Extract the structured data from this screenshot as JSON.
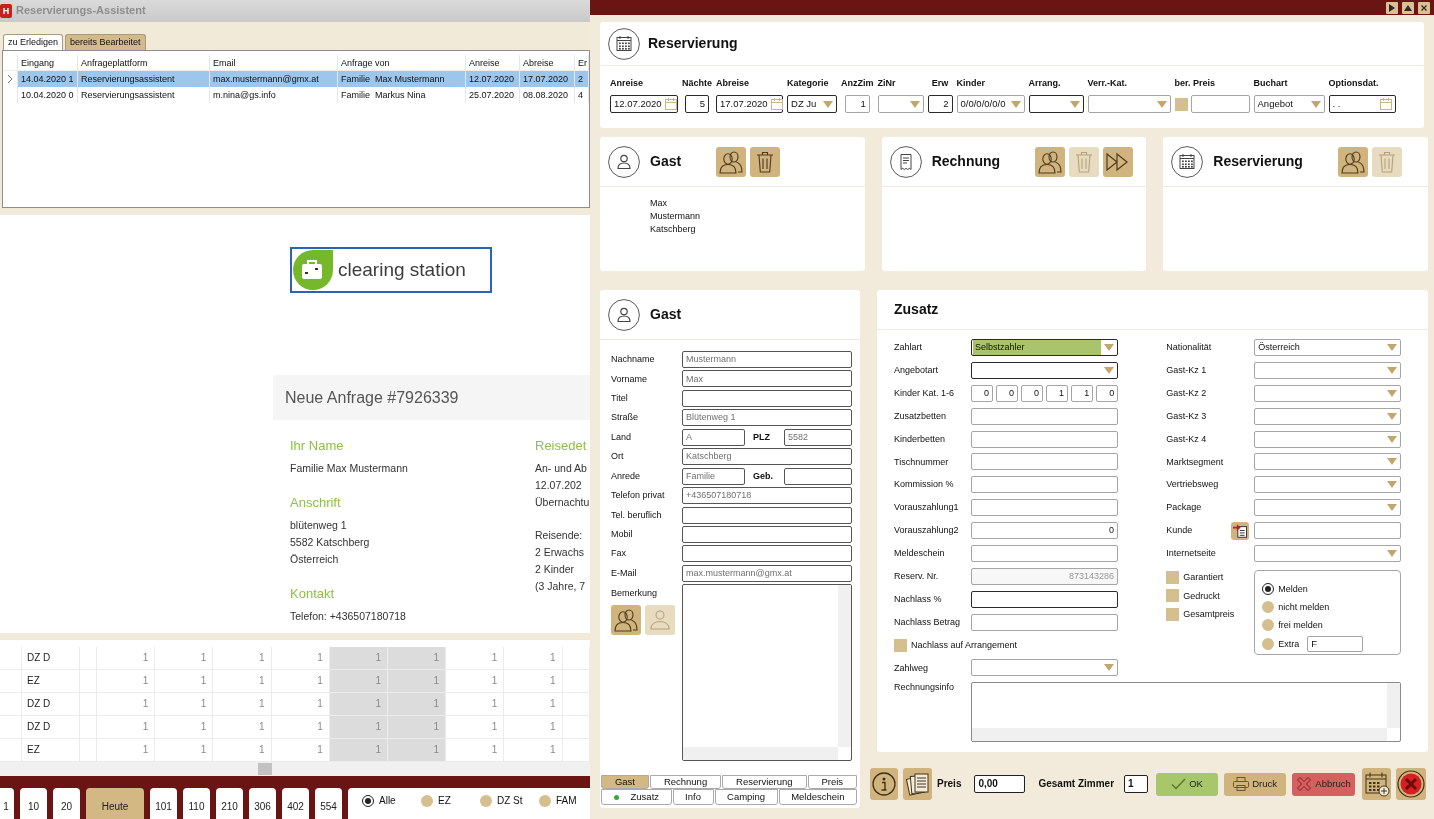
{
  "assistant": {
    "app_icon": "H",
    "title": "Reservierungs-Assistent",
    "tabs": [
      {
        "label": "zu Erledigen",
        "selected": true
      },
      {
        "label": "bereits Bearbeitet",
        "selected": false
      }
    ],
    "table": {
      "columns": [
        "Eingang",
        "Anfrageplattform",
        "Email",
        "Anfrage von",
        "Anreise",
        "Abreise",
        "Er"
      ],
      "rows": [
        {
          "selected": true,
          "cells": [
            "14.04.2020 1",
            "Reservierungsassistent",
            "max.mustermann@gmx.at",
            "Familie  Max Mustermann",
            "12.07.2020",
            "17.07.2020",
            "2"
          ]
        },
        {
          "selected": false,
          "cells": [
            "10.04.2020 0",
            "Reservierungsassistent",
            "m.nina@gs.info",
            "Familie  Markus Nina",
            "25.07.2020",
            "08.08.2020",
            "4"
          ]
        }
      ]
    }
  },
  "request_page": {
    "logo_text": "clearing station",
    "heading": "Neue Anfrage #7926339",
    "column_1": [
      {
        "title": "Ihr Name",
        "lines": [
          "Familie Max Mustermann"
        ]
      },
      {
        "title": "Anschrift",
        "lines": [
          "blütenweg 1",
          "5582 Katschberg",
          "Österreich"
        ]
      },
      {
        "title": "Kontakt",
        "lines": [
          "Telefon: +436507180718"
        ]
      }
    ],
    "column_2": [
      {
        "title": "Reisedet",
        "lines": [
          "An- und Ab",
          "12.07.202",
          "Übernachtu"
        ]
      },
      {
        "lines": [
          "Reisende:",
          "2 Erwachs",
          "2 Kinder",
          "(3 Jahre, 7"
        ]
      }
    ]
  },
  "room_grid": {
    "columns": [
      {
        "shaded": false
      },
      {
        "shaded": false
      },
      {
        "shaded": false
      },
      {
        "shaded": false
      },
      {
        "shaded": true
      },
      {
        "shaded": true
      },
      {
        "shaded": false
      },
      {
        "shaded": false
      }
    ],
    "rows": [
      {
        "label": "DZ D",
        "values": [
          "1",
          "1",
          "1",
          "1",
          "1",
          "1",
          "1",
          "1"
        ]
      },
      {
        "label": "EZ",
        "values": [
          "1",
          "1",
          "1",
          "1",
          "1",
          "1",
          "1",
          "1"
        ]
      },
      {
        "label": "DZ D",
        "values": [
          "1",
          "1",
          "1",
          "1",
          "1",
          "1",
          "1",
          "1"
        ]
      },
      {
        "label": "DZ D",
        "values": [
          "1",
          "1",
          "1",
          "1",
          "1",
          "1",
          "1",
          "1"
        ]
      },
      {
        "label": "EZ",
        "values": [
          "1",
          "1",
          "1",
          "1",
          "1",
          "1",
          "1",
          "1"
        ]
      }
    ]
  },
  "bottom_bar": {
    "buttons": [
      {
        "label": "1",
        "kind": "number"
      },
      {
        "label": "10",
        "kind": "number"
      },
      {
        "label": "20",
        "kind": "number"
      },
      {
        "label": "Heute",
        "kind": "today"
      },
      {
        "label": "101",
        "kind": "number"
      },
      {
        "label": "110",
        "kind": "number"
      },
      {
        "label": "210",
        "kind": "number"
      },
      {
        "label": "306",
        "kind": "number"
      },
      {
        "label": "402",
        "kind": "number"
      },
      {
        "label": "554",
        "kind": "number"
      }
    ],
    "filters": [
      {
        "label": "Alle",
        "selected": true
      },
      {
        "label": "EZ",
        "selected": false
      },
      {
        "label": "DZ St",
        "selected": false
      },
      {
        "label": "FAM",
        "selected": false
      }
    ]
  },
  "dialog": {
    "reservation": {
      "title": "Reservierung",
      "fields": [
        {
          "label": "Anreise",
          "kind": "date",
          "value": "12.07.2020",
          "emphasized": true
        },
        {
          "label": "Nächte",
          "kind": "number",
          "value": "5",
          "emphasized": true
        },
        {
          "label": "Abreise",
          "kind": "date",
          "value": "17.07.2020",
          "emphasized": true
        },
        {
          "label": "Kategorie",
          "kind": "select",
          "value": "DZ Ju",
          "emphasized": true
        },
        {
          "label": "AnzZim",
          "kind": "number",
          "value": "1",
          "emphasized": false
        },
        {
          "label": "ZiNr",
          "kind": "select",
          "emphasized": false
        },
        {
          "label": "Erw",
          "kind": "number",
          "value": "2",
          "emphasized": true
        },
        {
          "label": "Kinder",
          "kind": "select",
          "value": "0/0/0/0/0/0",
          "emphasized": false
        },
        {
          "label": "Arrang.",
          "kind": "select",
          "emphasized": true
        },
        {
          "label": "Verr.-Kat.",
          "kind": "select",
          "emphasized": false
        },
        {
          "label": "ber. Preis",
          "kind": "check_text",
          "checked": false,
          "emphasized": false
        },
        {
          "label": "Buchart",
          "kind": "select",
          "value": "Angebot",
          "emphasized": false
        },
        {
          "label": "Optionsdat.",
          "kind": "date",
          "value": ". .",
          "emphasized": true
        }
      ]
    },
    "cards": [
      {
        "title": "Gast",
        "kind": "guest",
        "buttons": [
          {
            "kind": "guests",
            "disabled": false
          },
          {
            "kind": "delete",
            "disabled": false
          }
        ],
        "lines": [
          "Max",
          "Mustermann",
          "Katschberg"
        ]
      },
      {
        "title": "Rechnung",
        "kind": "invoice",
        "buttons": [
          {
            "kind": "guests",
            "disabled": false
          },
          {
            "kind": "delete",
            "disabled": true
          },
          {
            "kind": "forward",
            "disabled": false
          }
        ]
      },
      {
        "title": "Reservierung",
        "kind": "reservation",
        "buttons": [
          {
            "kind": "guests",
            "disabled": false
          },
          {
            "kind": "delete",
            "disabled": true
          }
        ]
      }
    ],
    "guest_form": {
      "title": "Gast",
      "rows": [
        {
          "label": "Nachname",
          "value": "Mustermann"
        },
        {
          "label": "Vorname",
          "value": "Max"
        },
        {
          "label": "Titel"
        },
        {
          "label": "Straße",
          "value": "Blütenweg 1"
        },
        {
          "label": "Land",
          "value": "A",
          "second": {
            "label": "PLZ",
            "value": "5582"
          }
        },
        {
          "label": "Ort",
          "value": "Katschberg"
        },
        {
          "label": "Anrede",
          "value": "Familie",
          "second": {
            "label": "Geb."
          }
        },
        {
          "label": "Telefon privat",
          "value": "+436507180718"
        },
        {
          "label": "Tel. beruflich"
        },
        {
          "label": "Mobil"
        },
        {
          "label": "Fax"
        },
        {
          "label": "E-Mail",
          "value": "max.mustermann@gmx.at"
        }
      ],
      "remark_label": "Bemerkung",
      "buttons": [
        {
          "kind": "guests",
          "disabled": false
        },
        {
          "kind": "person",
          "disabled": true
        }
      ],
      "tabs": [
        [
          {
            "label": "Gast",
            "selected": true,
            "marked": false
          },
          {
            "label": "Rechnung",
            "selected": false,
            "marked": false
          },
          {
            "label": "Reservierung",
            "selected": false,
            "marked": false
          },
          {
            "label": "Preis",
            "selected": false,
            "marked": false
          }
        ],
        [
          {
            "label": "Zusatz",
            "selected": false,
            "marked": true
          },
          {
            "label": "Info",
            "selected": false,
            "marked": false
          },
          {
            "label": "Camping",
            "selected": false,
            "marked": false
          },
          {
            "label": "Meldeschein",
            "selected": false,
            "marked": false
          }
        ]
      ]
    },
    "extras": {
      "title": "Zusatz",
      "left": [
        {
          "label": "Zahlart",
          "kind": "select",
          "value": "Selbstzahler",
          "highlighted": true,
          "emphasized": true
        },
        {
          "label": "Angebotart",
          "kind": "select",
          "highlighted": false,
          "emphasized": true
        },
        {
          "label": "Kinder Kat. 1-6",
          "kind": "multi",
          "values": [
            "0",
            "0",
            "0",
            "1",
            "1",
            "0"
          ],
          "emphasized": false
        },
        {
          "label": "Zusatzbetten",
          "kind": "text",
          "emphasized": false
        },
        {
          "label": "Kinderbetten",
          "kind": "text",
          "emphasized": false
        },
        {
          "label": "Tischnummer",
          "kind": "text",
          "emphasized": false
        },
        {
          "label": "Kommission %",
          "kind": "text",
          "emphasized": false
        },
        {
          "label": "Vorauszahlung1",
          "kind": "text",
          "emphasized": false
        },
        {
          "label": "Vorauszahlung2",
          "kind": "number",
          "value": "0",
          "emphasized": false
        },
        {
          "label": "Meldeschein",
          "kind": "text",
          "emphasized": false
        },
        {
          "label": "Reserv. Nr.",
          "kind": "readonly",
          "value": "873143286",
          "emphasized": false
        },
        {
          "label": "Nachlass %",
          "kind": "text",
          "emphasized": true
        },
        {
          "label": "Nachlass Betrag",
          "kind": "text",
          "emphasized": false
        },
        {
          "label": "Nachlass auf Arrangement",
          "kind": "checkbox",
          "checked": false
        },
        {
          "label": "Zahlweg",
          "kind": "select",
          "highlighted": false,
          "emphasized": false
        }
      ],
      "right": [
        {
          "label": "Nationalität",
          "kind": "select",
          "value": "Österreich"
        },
        {
          "label": "Gast-Kz 1",
          "kind": "select"
        },
        {
          "label": "Gast-Kz 2",
          "kind": "select"
        },
        {
          "label": "Gast-Kz 3",
          "kind": "select"
        },
        {
          "label": "Gast-Kz 4",
          "kind": "select"
        },
        {
          "label": "Marktsegment",
          "kind": "select"
        },
        {
          "label": "Vertriebsweg",
          "kind": "select"
        },
        {
          "label": "Package",
          "kind": "select"
        },
        {
          "label": "Kunde",
          "kind": "lookup"
        },
        {
          "label": "Internetseite",
          "kind": "select"
        }
      ],
      "checkboxes": [
        {
          "label": "Garantiert",
          "checked": false
        },
        {
          "label": "Gedruckt",
          "checked": false
        },
        {
          "label": "Gesamtpreis",
          "checked": false
        }
      ],
      "report_options": [
        {
          "label": "Melden",
          "selected": true
        },
        {
          "label": "nicht melden",
          "selected": false
        },
        {
          "label": "frei melden",
          "selected": false
        },
        {
          "label": "Extra",
          "selected": false,
          "value": "F"
        }
      ],
      "invoice_info_label": "Rechnungsinfo"
    },
    "toolbar": {
      "price_label": "Preis",
      "price": "0,00",
      "rooms_label": "Gesamt Zimmer",
      "rooms": "1",
      "buttons": [
        {
          "label": "OK",
          "kind": "ok"
        },
        {
          "label": "Druck",
          "kind": "print"
        },
        {
          "label": "Abbruch",
          "kind": "cancel"
        }
      ]
    }
  }
}
